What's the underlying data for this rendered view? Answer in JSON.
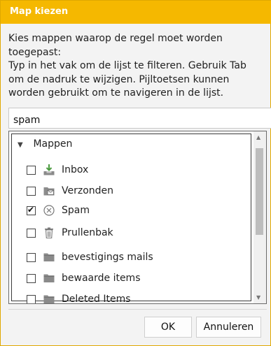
{
  "dialog": {
    "title": "Map kiezen",
    "instructions": [
      "Kies mappen waarop de regel moet worden",
      "toegepast:",
      "Typ in het vak om de lijst te filteren. Gebruik Tab",
      "om de nadruk te wijzigen. Pijltoetsen kunnen",
      "worden gebruikt om te navigeren in de lijst."
    ],
    "filter_value": "spam",
    "group_label": "Mappen",
    "folders": [
      {
        "label": "Inbox",
        "checked": false,
        "icon": "inbox-icon"
      },
      {
        "label": "Verzonden",
        "checked": false,
        "icon": "sent-folder-icon"
      },
      {
        "label": "Spam",
        "checked": true,
        "icon": "spam-icon"
      },
      {
        "label": "Prullenbak",
        "checked": false,
        "icon": "trash-icon"
      },
      {
        "label": "bevestigings mails",
        "checked": false,
        "icon": "folder-icon"
      },
      {
        "label": "bewaarde items",
        "checked": false,
        "icon": "folder-icon"
      },
      {
        "label": "Deleted Items",
        "checked": false,
        "icon": "folder-icon"
      }
    ],
    "ok_label": "OK",
    "cancel_label": "Annuleren"
  },
  "colors": {
    "titlebar": "#f5b800",
    "dialog_bg": "#f3f3f3"
  }
}
